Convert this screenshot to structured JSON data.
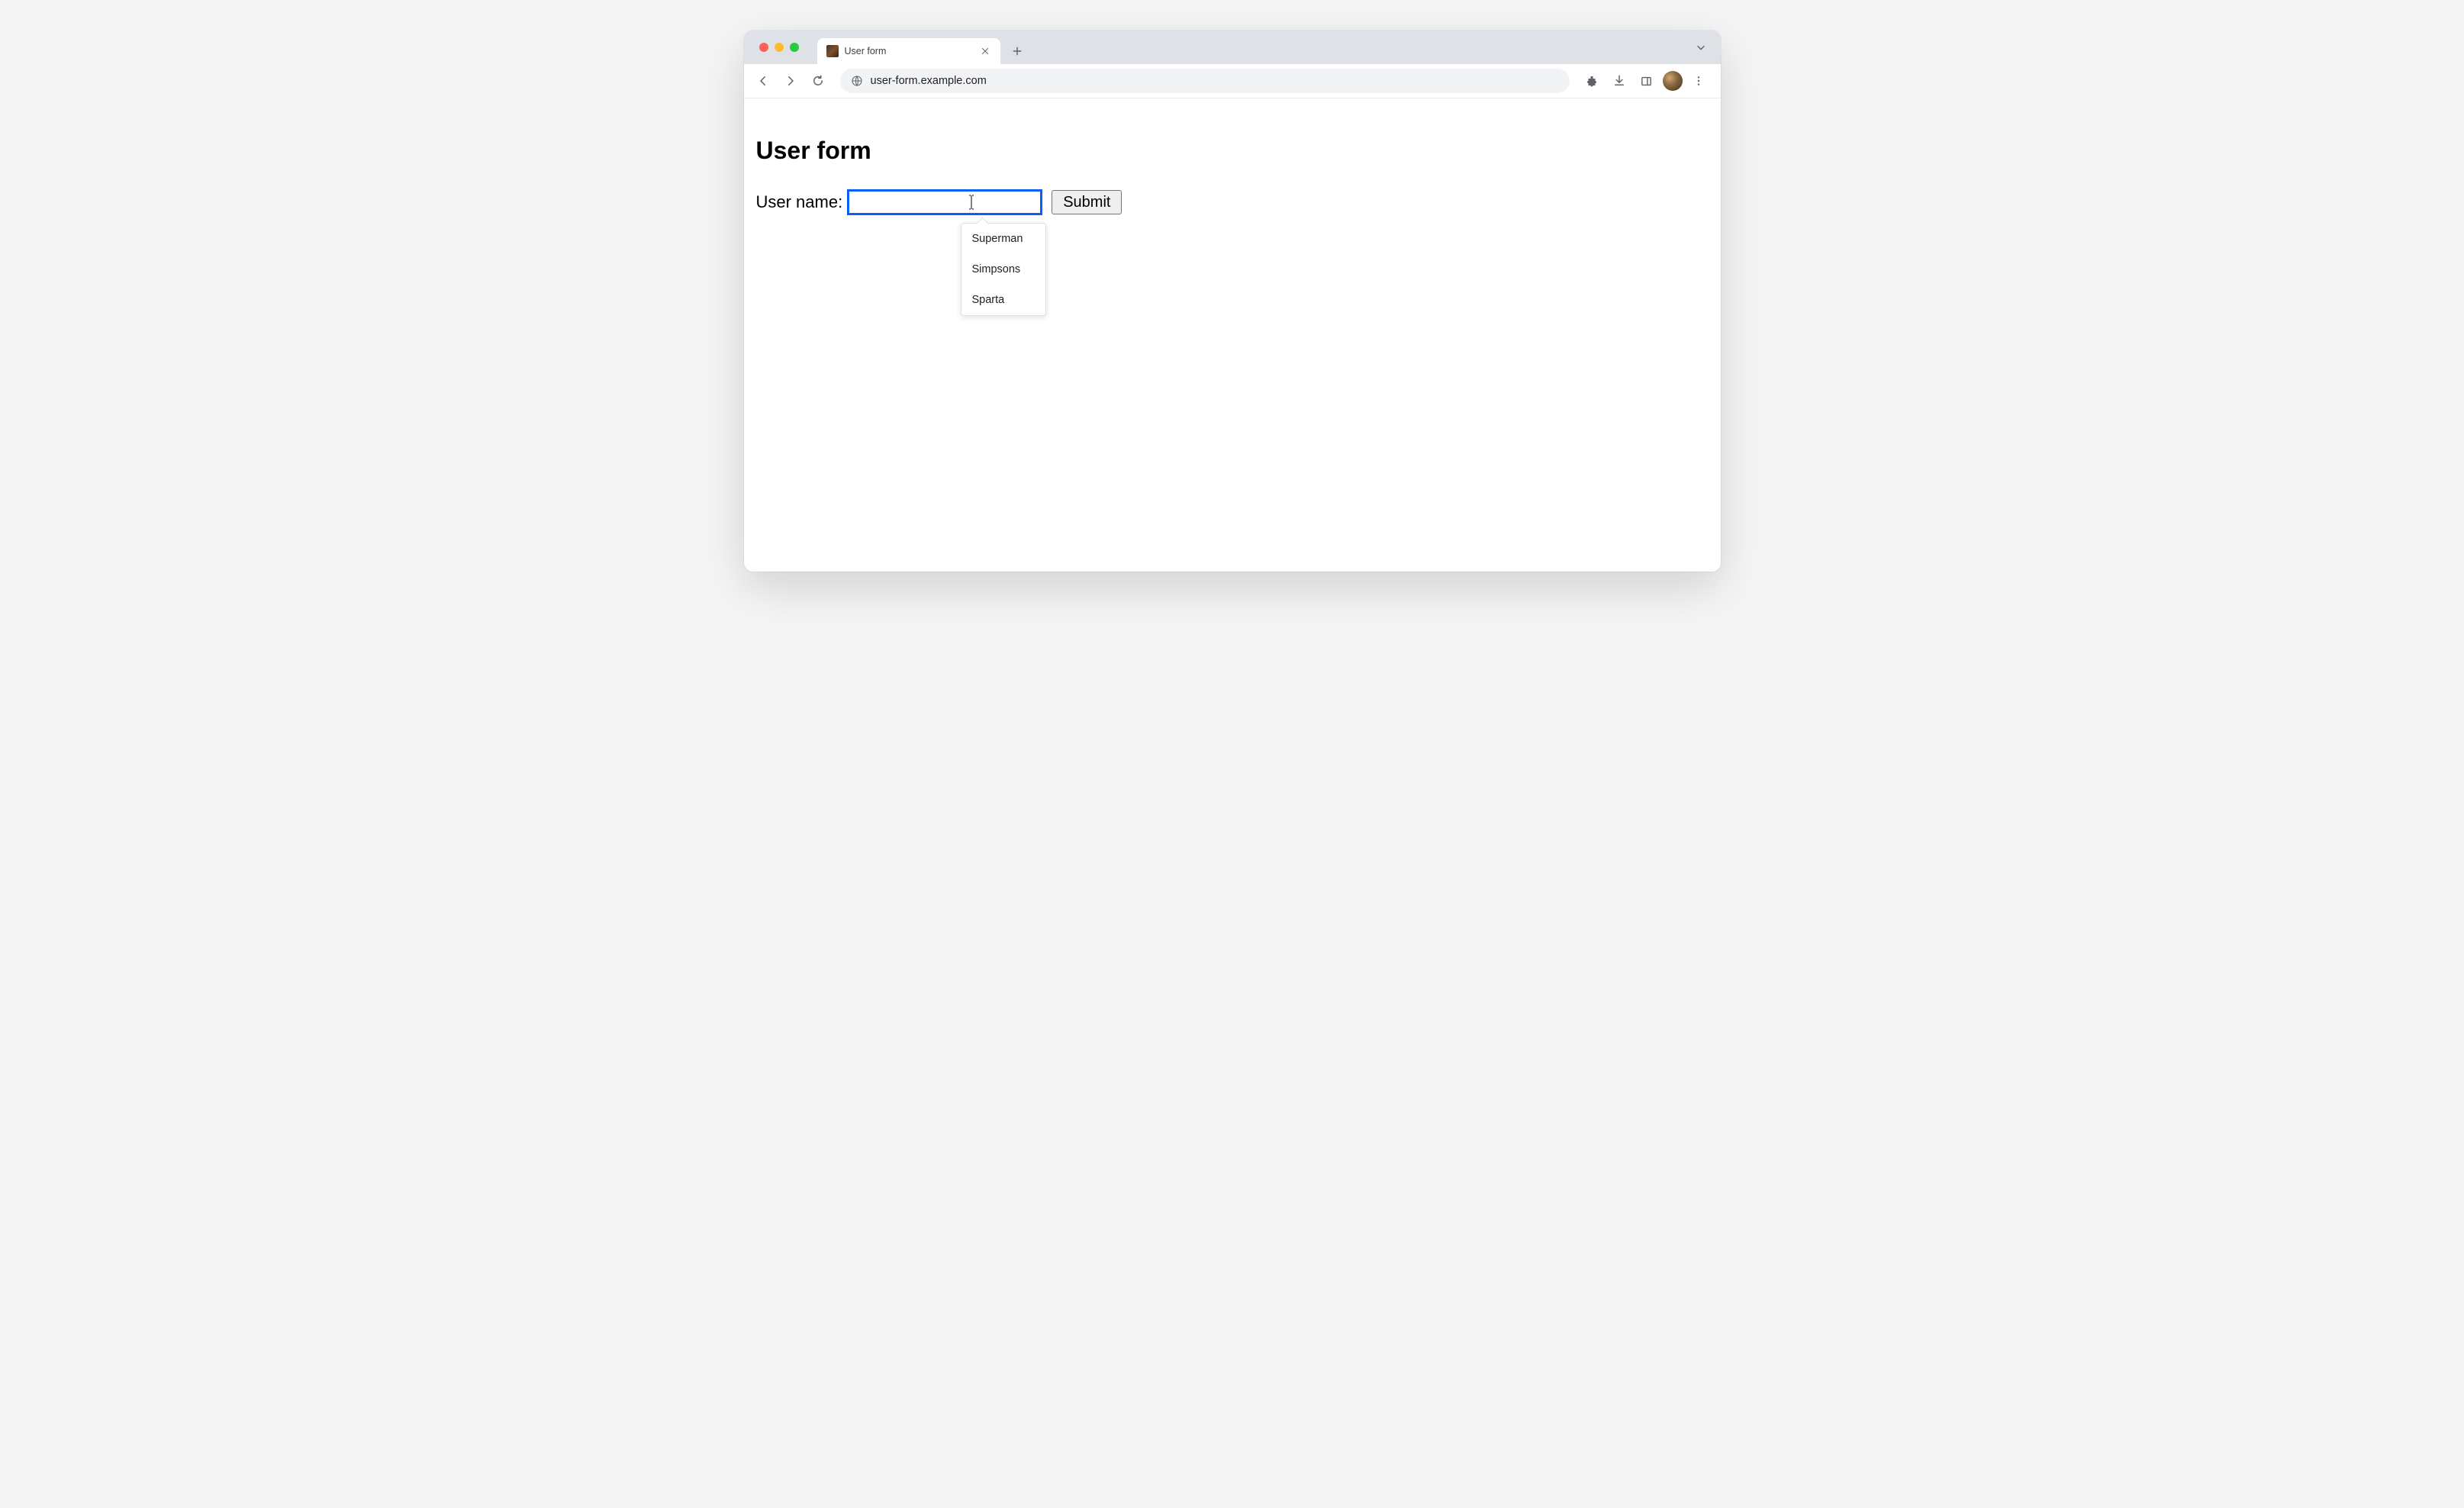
{
  "browser": {
    "tab": {
      "title": "User form"
    },
    "url": "user-form.example.com"
  },
  "page": {
    "heading": "User form",
    "form": {
      "username_label": "User name:",
      "username_value": "",
      "submit_label": "Submit"
    },
    "autocomplete": {
      "items": [
        "Superman",
        "Simpsons",
        "Sparta"
      ]
    }
  }
}
